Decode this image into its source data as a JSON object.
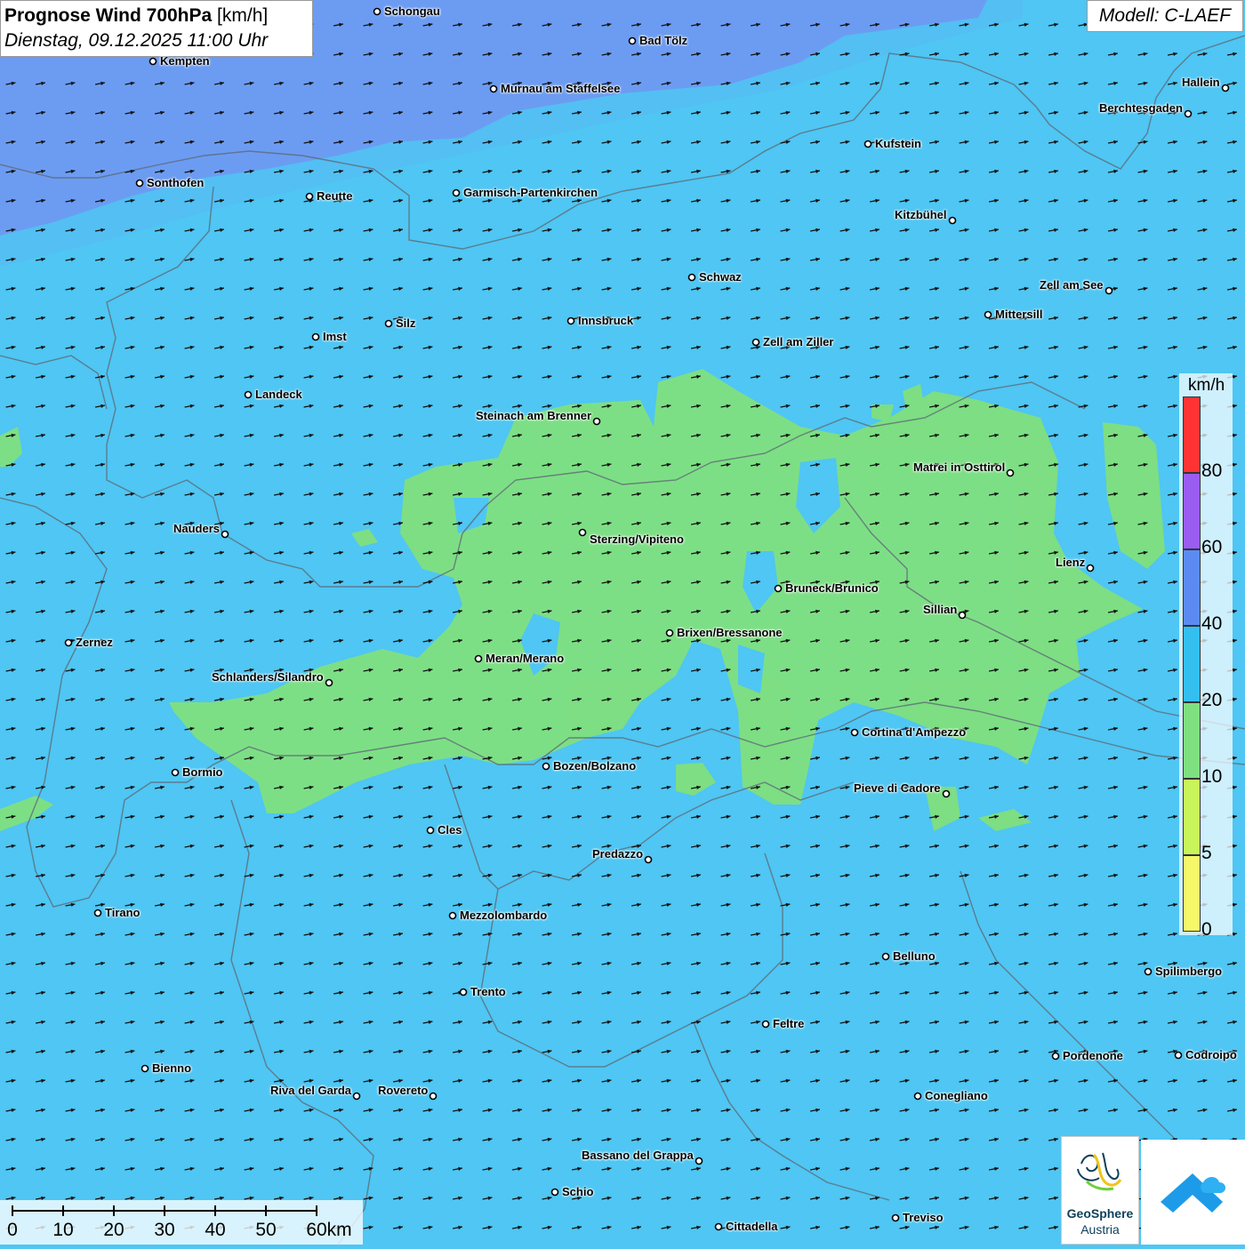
{
  "title": {
    "bold": "Prognose Wind 700hPa",
    "unit": " [km/h]",
    "datetime": "Dienstag, 09.12.2025 11:00 Uhr"
  },
  "model": "Modell: C-LAEF",
  "legend": {
    "unit": "km/h",
    "bins": [
      {
        "label": "80",
        "color": "#ff3333"
      },
      {
        "label": "60",
        "color": "#9b5cf2"
      },
      {
        "label": "40",
        "color": "#5b8bf2"
      },
      {
        "label": "20",
        "color": "#33bff0"
      },
      {
        "label": "10",
        "color": "#7fe07f"
      },
      {
        "label": "5",
        "color": "#c8f55a"
      },
      {
        "label": "0",
        "color": "#f7f76a"
      }
    ]
  },
  "scale": {
    "labels": [
      "0",
      "10",
      "20",
      "30",
      "40",
      "50",
      "60km"
    ]
  },
  "logo": {
    "line1": "GeoSphere",
    "line2": "Austria"
  },
  "wind": {
    "direction_deg": 80,
    "dominant_band_kmh": "10–40"
  },
  "cities": [
    {
      "name": "Schongau"
    },
    {
      "name": "Bad Tölz"
    },
    {
      "name": "Kempten"
    },
    {
      "name": "Murnau am Staffelsee"
    },
    {
      "name": "Hallein"
    },
    {
      "name": "Berchtesgaden"
    },
    {
      "name": "Kufstein"
    },
    {
      "name": "Sonthofen"
    },
    {
      "name": "Reutte"
    },
    {
      "name": "Garmisch-Partenkirchen"
    },
    {
      "name": "Kitzbühel"
    },
    {
      "name": "Schwaz"
    },
    {
      "name": "Zell am See"
    },
    {
      "name": "Mittersill"
    },
    {
      "name": "Innsbruck"
    },
    {
      "name": "Silz"
    },
    {
      "name": "Imst"
    },
    {
      "name": "Zell am Ziller"
    },
    {
      "name": "Landeck"
    },
    {
      "name": "Steinach am Brenner"
    },
    {
      "name": "Matrei in Osttirol"
    },
    {
      "name": "Nauders"
    },
    {
      "name": "Sterzing/Vipiteno"
    },
    {
      "name": "Lienz"
    },
    {
      "name": "Bruneck/Brunico"
    },
    {
      "name": "Sillian"
    },
    {
      "name": "Brixen/Bressanone"
    },
    {
      "name": "Zernez"
    },
    {
      "name": "Meran/Merano"
    },
    {
      "name": "Schlanders/Silandro"
    },
    {
      "name": "Cortina d'Ampezzo"
    },
    {
      "name": "Bozen/Bolzano"
    },
    {
      "name": "Bormio"
    },
    {
      "name": "Pieve di Cadore"
    },
    {
      "name": "Cles"
    },
    {
      "name": "Predazzo"
    },
    {
      "name": "Tirano"
    },
    {
      "name": "Mezzolombardo"
    },
    {
      "name": "Belluno"
    },
    {
      "name": "Spilimbergo"
    },
    {
      "name": "Trento"
    },
    {
      "name": "Feltre"
    },
    {
      "name": "Pordenone"
    },
    {
      "name": "Codroipo"
    },
    {
      "name": "Bienno"
    },
    {
      "name": "Riva del Garda"
    },
    {
      "name": "Rovereto"
    },
    {
      "name": "Conegliano"
    },
    {
      "name": "Bassano del Grappa"
    },
    {
      "name": "Schio"
    },
    {
      "name": "Treviso"
    },
    {
      "name": "Cittadella"
    }
  ]
}
